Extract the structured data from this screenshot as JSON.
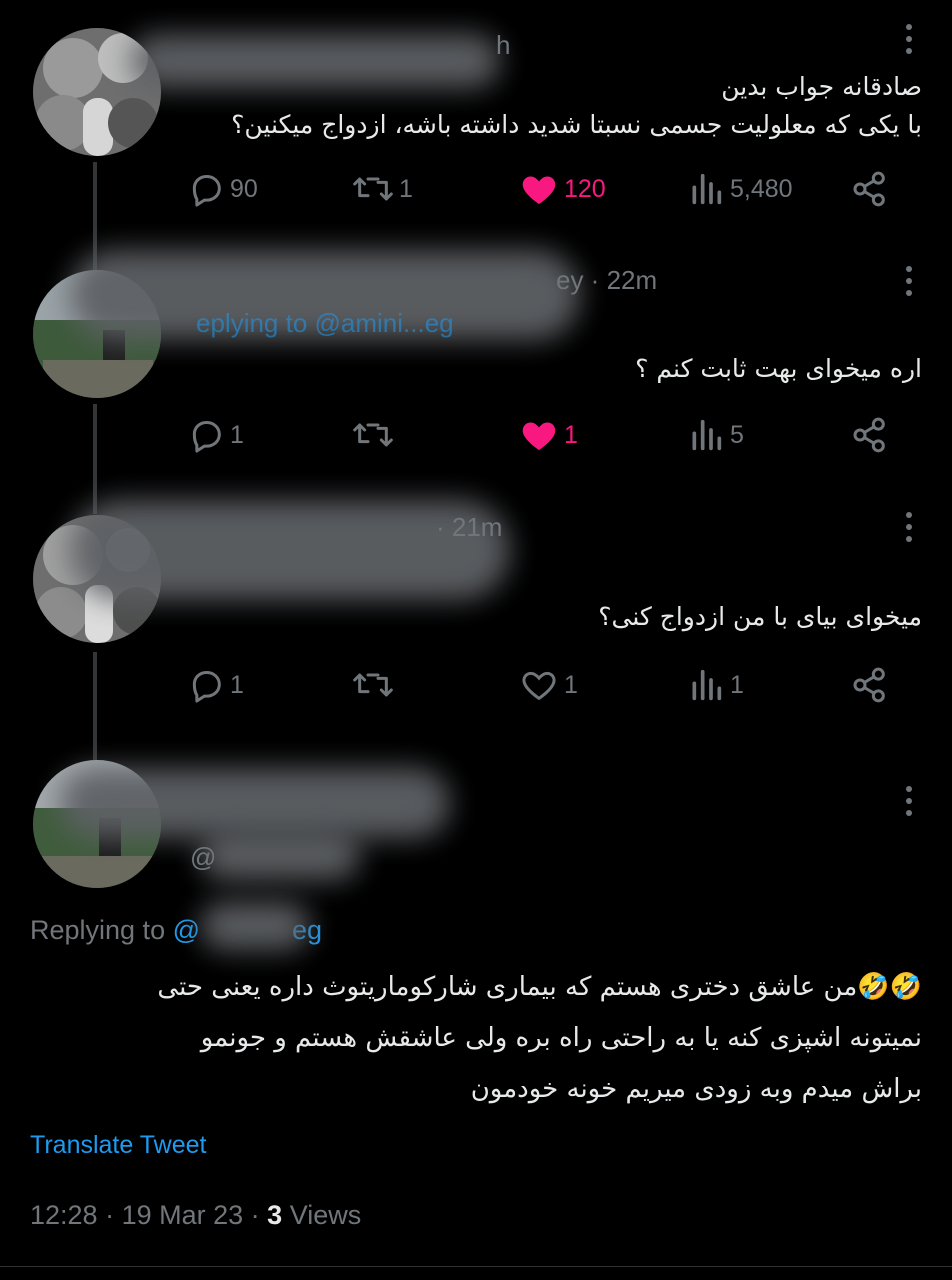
{
  "tweets": [
    {
      "name_tail": "h",
      "text_line1": "صادقانه جواب بدین",
      "text_line2": "با یکی که معلولیت جسمی نسبتا شدید داشته باشه، ازدواج میکنین؟",
      "replies": "90",
      "retweets": "1",
      "likes": "120",
      "views": "5,480",
      "liked": true
    },
    {
      "name_tail": "ey · 22m",
      "replying_fragment": "eplying to @amini...eg",
      "text": "اره میخوای بهت ثابت کنم ؟",
      "replies": "1",
      "retweets": "",
      "likes": "1",
      "views": "5",
      "liked": true
    },
    {
      "name_tail": "· 21m",
      "text": "میخوای بیای با من ازدواج کنی؟",
      "replies": "1",
      "retweets": "",
      "likes": "1",
      "views": "1",
      "liked": false
    }
  ],
  "main_tweet": {
    "handle_prefix": "@",
    "replying_label": "Replying to",
    "replying_handle_start": "@",
    "replying_handle_end": "eg",
    "text_line1": "🤣🤣من عاشق دختری هستم که بیماری شارکوماریتوث داره یعنی حتی",
    "text_line2": "نمیتونه اشپزی کنه یا به راحتی راه بره ولی عاشقش هستم و جونمو",
    "text_line3": "براش میدم وبه زودی میریم خونه خودمون",
    "translate_label": "Translate Tweet",
    "time": "12:28",
    "date": "19 Mar 23",
    "views_count": "3",
    "views_label": "Views"
  },
  "icons": {
    "reply": "reply-icon",
    "retweet": "retweet-icon",
    "like": "heart-icon",
    "views": "views-icon",
    "share": "share-icon",
    "more": "more-icon"
  },
  "colors": {
    "like": "#f91880",
    "link": "#1d9bf0",
    "muted": "#71767b",
    "text": "#e7e9ea"
  }
}
